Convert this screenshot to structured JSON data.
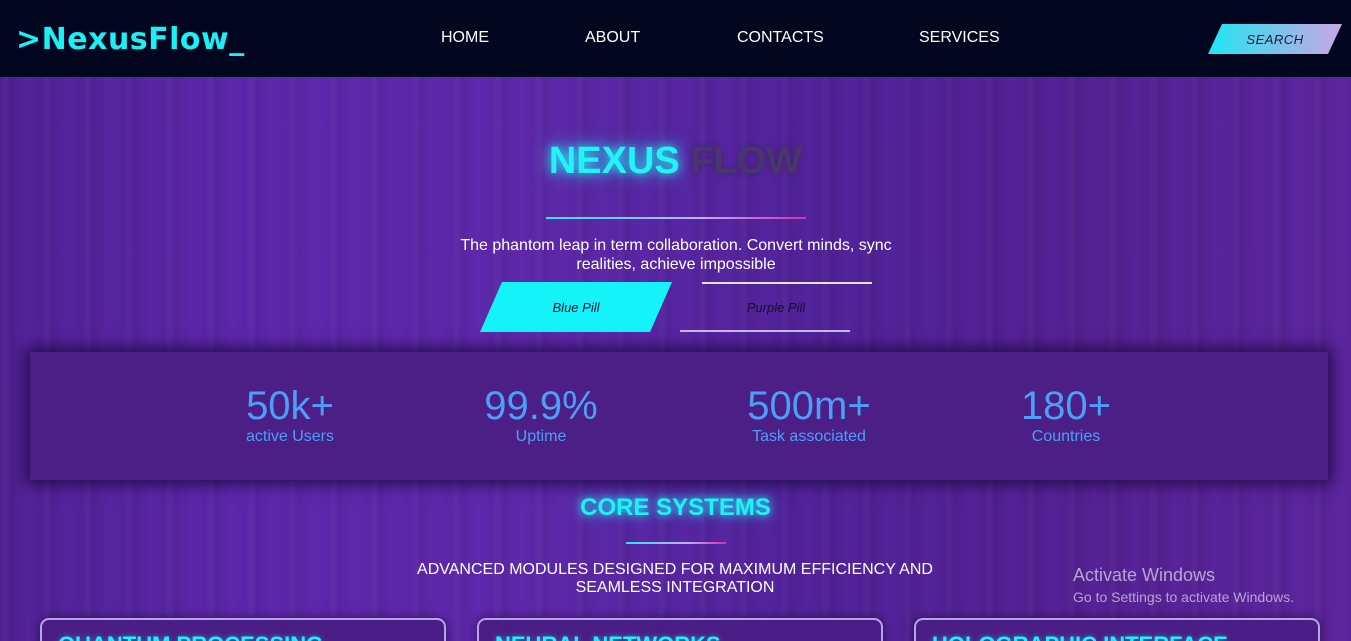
{
  "nav": {
    "logo": ">NexusFlow_",
    "links": [
      "HOME",
      "ABOUT",
      "CONTACTS",
      "SERVICES"
    ],
    "search_label": "SEARCH"
  },
  "hero": {
    "title_a": "NEXUS",
    "title_b": "FLOW",
    "subtitle": "The phantom leap in term collaboration. Convert minds, sync realities, achieve impossible",
    "blue_pill": "Blue Pill",
    "purple_pill": "Purple Pill"
  },
  "stats": [
    {
      "value": "50k+",
      "label": "active Users"
    },
    {
      "value": "99.9%",
      "label": "Uptime"
    },
    {
      "value": "500m+",
      "label": "Task associated"
    },
    {
      "value": "180+",
      "label": "Countries"
    }
  ],
  "core": {
    "title": "CORE SYSTEMS",
    "subtitle": "ADVANCED MODULES DESIGNED FOR MAXIMUM EFFICIENCY AND SEAMLESS INTEGRATION",
    "cards": [
      "QUANTUM PROCESSING",
      "NEURAL NETWORKS",
      "HOLOGRAPHIC INTERFACE"
    ]
  },
  "watermark": {
    "title": "Activate Windows",
    "subtitle": "Go to Settings to activate Windows."
  }
}
